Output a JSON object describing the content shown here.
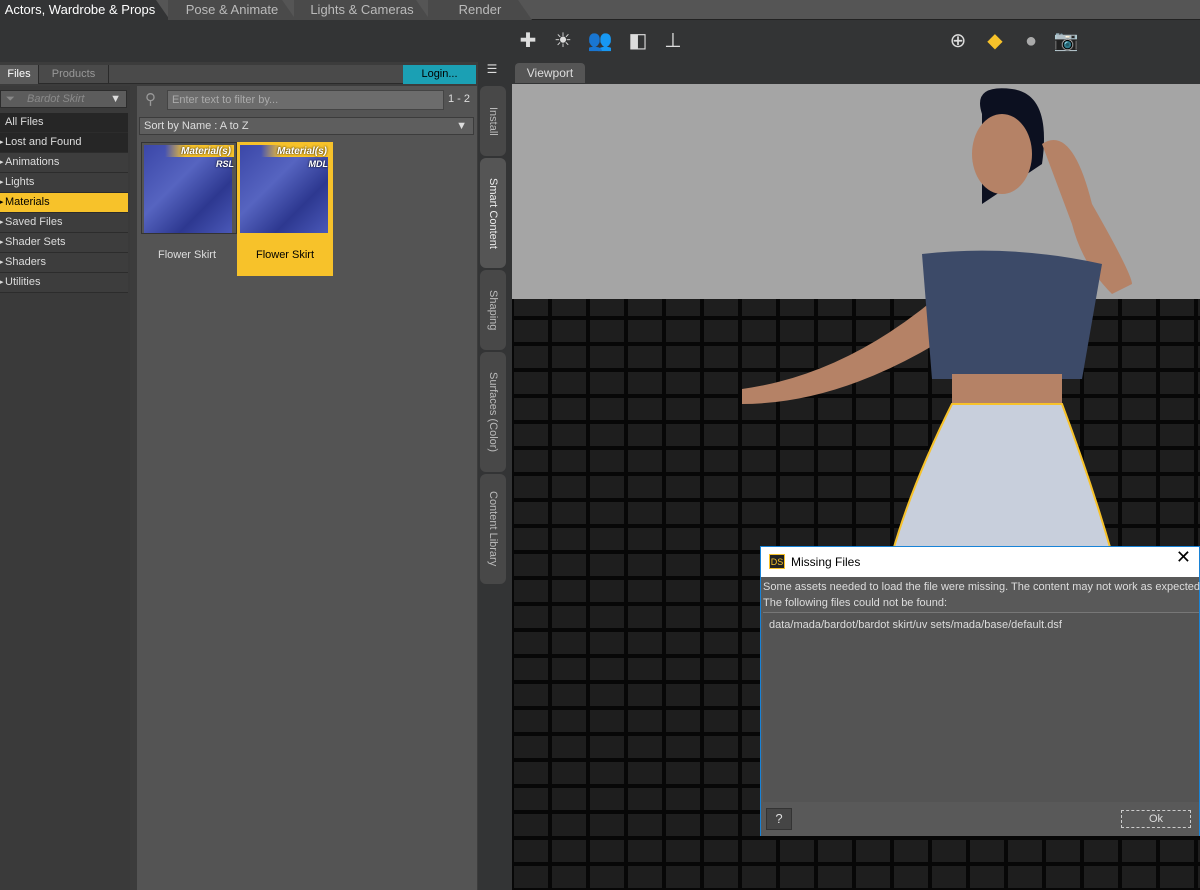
{
  "tabs": [
    "Actors, Wardrobe & Props",
    "Pose & Animate",
    "Lights & Cameras",
    "Render"
  ],
  "toolbar": {
    "left_icons": [
      "create-light-icon",
      "environment-icon",
      "transfer-figure-icon",
      "save-material-preset-icon",
      "save-pose-preset-icon"
    ],
    "right_icons": [
      "universal-tool-icon",
      "surface-selection-icon",
      "figure-select-icon",
      "camera-icon"
    ]
  },
  "panel": {
    "tabs": [
      "Files",
      "Products"
    ],
    "login": "Login...",
    "filter": "Bardot Skirt",
    "search_placeholder": "Enter text to filter by...",
    "count": "1 - 2",
    "sort": "Sort by Name : A to Z",
    "categories": [
      "All Files",
      "Lost and Found",
      "Animations",
      "Lights",
      "Materials",
      "Saved Files",
      "Shader Sets",
      "Shaders",
      "Utilities"
    ],
    "selected_category": "Materials",
    "items": [
      {
        "badge": "Material(s)",
        "type": "RSL",
        "label": "Flower Skirt"
      },
      {
        "badge": "Material(s)",
        "type": "MDL",
        "label": "Flower Skirt",
        "selected": true
      }
    ]
  },
  "side_tabs": [
    "Install",
    "Smart Content",
    "Shaping",
    "Surfaces (Color)",
    "Content Library"
  ],
  "viewport": {
    "tab": "Viewport"
  },
  "dialog": {
    "title": "Missing Files",
    "logo": "DS",
    "message1": "Some assets needed to load the file were missing. The content may not work as expected.",
    "message2": "The following files could not be found:",
    "files": [
      "data/mada/bardot/bardot skirt/uv sets/mada/base/default.dsf"
    ],
    "help": "?",
    "ok": "Ok"
  },
  "colors": {
    "accent": "#f7c22a",
    "login": "#1ba0b4"
  }
}
